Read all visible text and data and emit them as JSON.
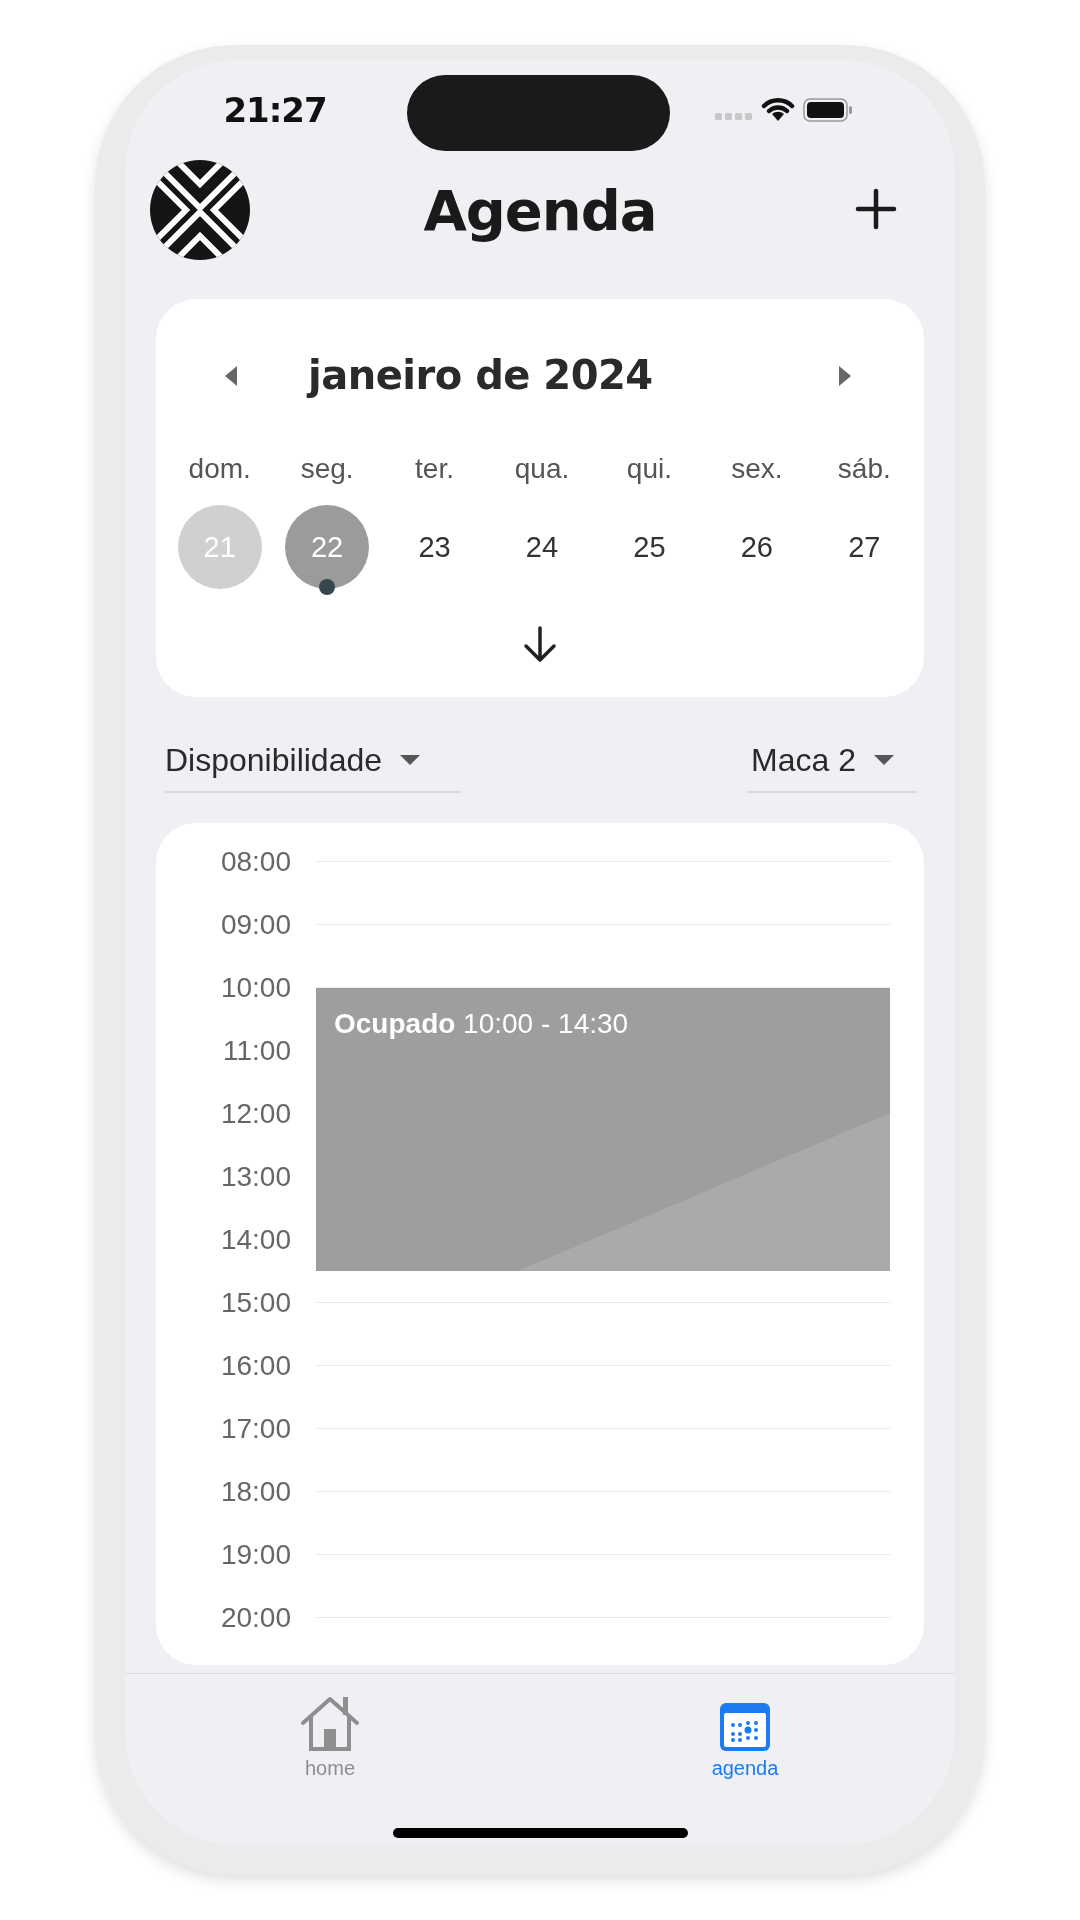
{
  "status_bar": {
    "time": "21:27"
  },
  "header": {
    "title": "Agenda"
  },
  "calendar": {
    "month": "janeiro de 2024",
    "days": [
      {
        "weekday": "dom.",
        "date": "21",
        "today": true,
        "selected": false,
        "has_events": false
      },
      {
        "weekday": "seg.",
        "date": "22",
        "today": false,
        "selected": true,
        "has_events": true
      },
      {
        "weekday": "ter.",
        "date": "23",
        "today": false,
        "selected": false,
        "has_events": false
      },
      {
        "weekday": "qua.",
        "date": "24",
        "today": false,
        "selected": false,
        "has_events": false
      },
      {
        "weekday": "qui.",
        "date": "25",
        "today": false,
        "selected": false,
        "has_events": false
      },
      {
        "weekday": "sex.",
        "date": "26",
        "today": false,
        "selected": false,
        "has_events": false
      },
      {
        "weekday": "sáb.",
        "date": "27",
        "today": false,
        "selected": false,
        "has_events": false
      }
    ]
  },
  "filters": [
    {
      "value": "Disponibilidade"
    },
    {
      "value": "Maca 2"
    }
  ],
  "timeline": {
    "hours": [
      "08:00",
      "09:00",
      "10:00",
      "11:00",
      "12:00",
      "13:00",
      "14:00",
      "15:00",
      "16:00",
      "17:00",
      "18:00",
      "19:00",
      "20:00"
    ],
    "events": [
      {
        "title": "Ocupado",
        "time": "10:00 - 14:30"
      }
    ]
  },
  "tabs": [
    {
      "label": "home",
      "kind": "home",
      "selected": false
    },
    {
      "label": "agenda",
      "kind": "calendar",
      "selected": true
    }
  ]
}
